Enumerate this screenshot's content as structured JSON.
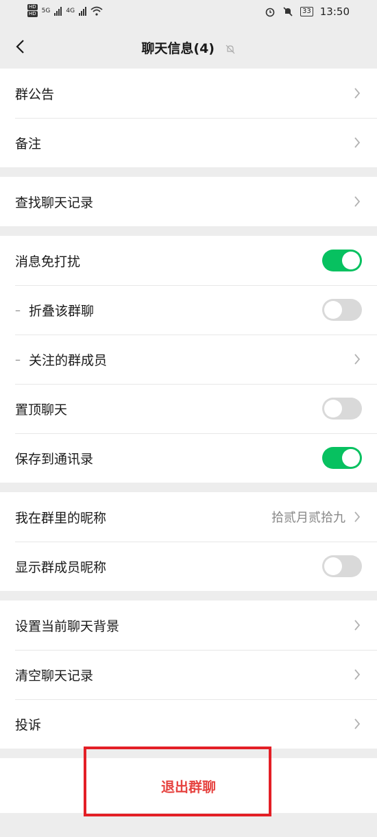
{
  "status_bar": {
    "hd1": "HD",
    "hd2": "HD",
    "net1": "5G",
    "net2": "4G",
    "battery": "33",
    "time": "13:50"
  },
  "nav": {
    "title": "聊天信息(4)"
  },
  "sections": [
    {
      "rows": [
        {
          "label": "群公告"
        },
        {
          "label": "备注"
        }
      ]
    },
    {
      "rows": [
        {
          "label": "查找聊天记录"
        }
      ]
    },
    {
      "rows": [
        {
          "label": "消息免打扰",
          "toggle": true
        },
        {
          "label": "折叠该群聊",
          "toggle": false
        },
        {
          "label": "关注的群成员"
        },
        {
          "label": "置顶聊天",
          "toggle": false
        },
        {
          "label": "保存到通讯录",
          "toggle": true
        }
      ]
    },
    {
      "rows": [
        {
          "label": "我在群里的昵称",
          "value": "拾贰月贰拾九"
        },
        {
          "label": "显示群成员昵称",
          "toggle": false
        }
      ]
    },
    {
      "rows": [
        {
          "label": "设置当前聊天背景"
        },
        {
          "label": "清空聊天记录"
        },
        {
          "label": "投诉"
        }
      ]
    }
  ],
  "dash_glyph": "–",
  "exit_label": "退出群聊",
  "colors": {
    "toggle_on": "#07c160",
    "exit_text": "#e64340",
    "highlight": "#e31f26"
  }
}
